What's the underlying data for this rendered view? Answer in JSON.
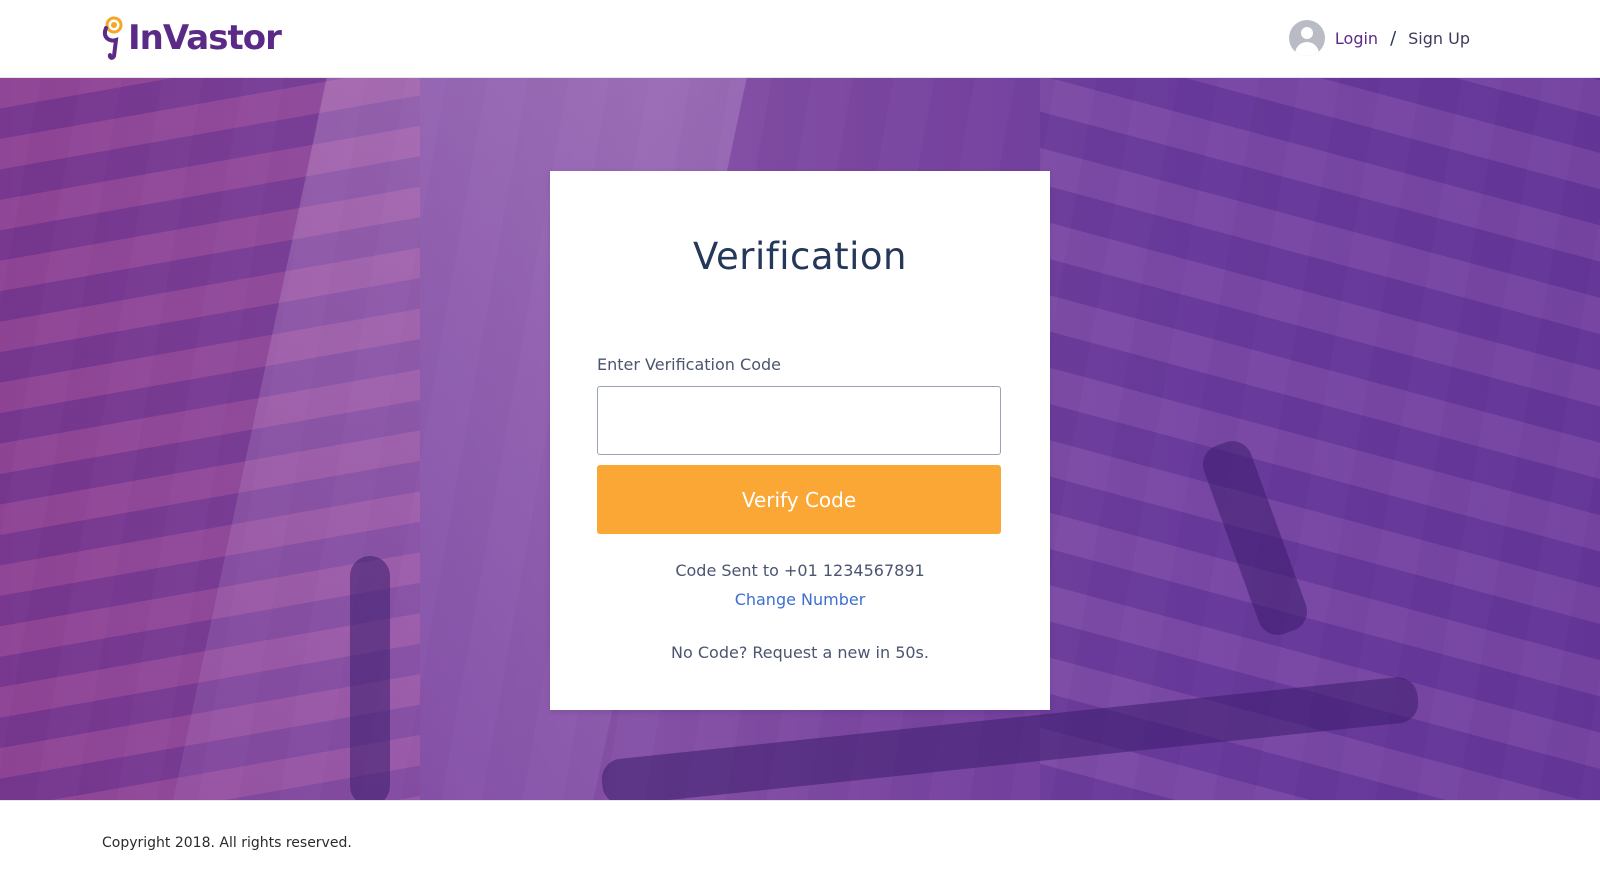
{
  "header": {
    "logo_text": "InVastor",
    "login_label": "Login",
    "separator": "/",
    "signup_label": "Sign Up"
  },
  "card": {
    "title": "Verification",
    "field_label": "Enter Verification Code",
    "input_value": "",
    "input_placeholder": "",
    "button_label": "Verify Code",
    "sent_text": "Code Sent to +01 1234567891",
    "change_number_label": "Change Number",
    "resend_text": "No Code? Request a new in 50s."
  },
  "footer": {
    "copyright": "Copyright 2018. All rights reserved."
  },
  "colors": {
    "brand_purple": "#5b2a86",
    "button_orange": "#fba735",
    "link_blue": "#3c6fd1",
    "hero_overlay": "#6e32a0"
  },
  "icons": {
    "logo": "invastor-logo-icon",
    "avatar": "user-avatar-icon"
  }
}
